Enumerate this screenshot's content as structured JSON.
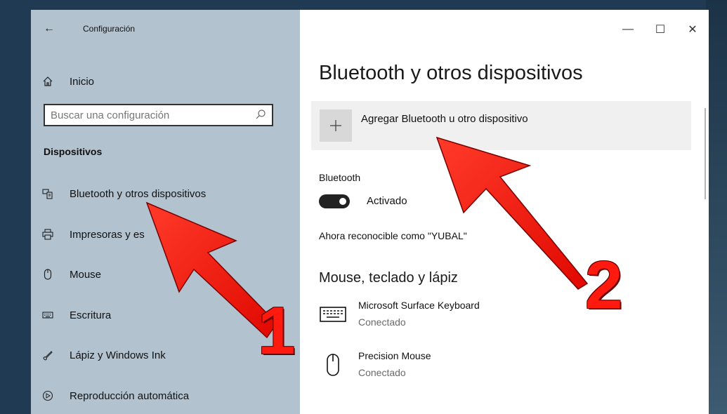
{
  "window": {
    "title": "Configuración",
    "back_glyph": "←",
    "minimize_glyph": "—",
    "maximize_glyph": "☐",
    "close_glyph": "✕"
  },
  "sidebar": {
    "home_label": "Inicio",
    "search_placeholder": "Buscar una configuración",
    "section_title": "Dispositivos",
    "items": [
      {
        "label": "Bluetooth y otros dispositivos",
        "icon": "bluetooth-devices-icon",
        "selected": true
      },
      {
        "label": "Impresoras y es",
        "icon": "printer-icon"
      },
      {
        "label": "Mouse",
        "icon": "mouse-icon"
      },
      {
        "label": "Escritura",
        "icon": "keyboard-icon"
      },
      {
        "label": "Lápiz y Windows Ink",
        "icon": "pen-icon"
      },
      {
        "label": "Reproducción automática",
        "icon": "autoplay-icon"
      }
    ]
  },
  "main": {
    "title": "Bluetooth y otros dispositivos",
    "add_device_label": "Agregar Bluetooth u otro dispositivo",
    "bluetooth_label": "Bluetooth",
    "bluetooth_state": "Activado",
    "discoverable_text": "Ahora reconocible como \"YUBAL\"",
    "section_title": "Mouse, teclado y lápiz",
    "devices": [
      {
        "name": "Microsoft Surface Keyboard",
        "status": "Conectado",
        "icon": "keyboard-icon"
      },
      {
        "name": "Precision Mouse",
        "status": "Conectado",
        "icon": "mouse-icon"
      }
    ]
  },
  "annotations": {
    "step1": "1",
    "step2": "2",
    "arrow_color": "#ff1a10"
  }
}
